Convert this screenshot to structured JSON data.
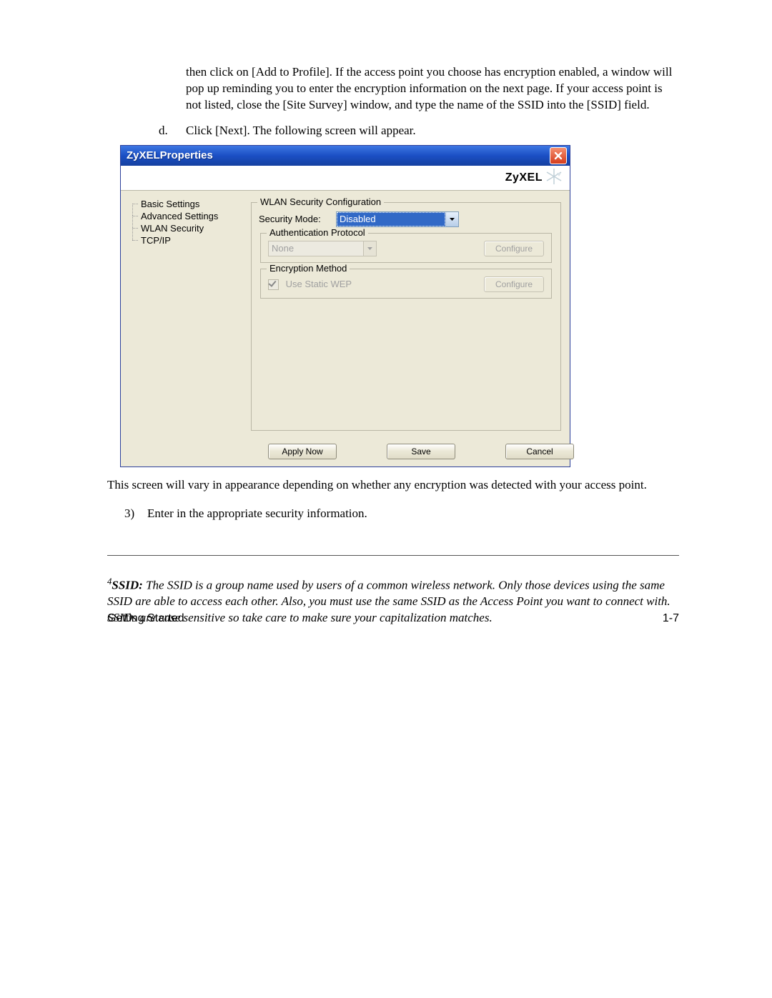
{
  "doc": {
    "para1": "then click on [Add to Profile].  If the access point you choose has encryption enabled, a window will pop up reminding you to enter the encryption information on the next page.  If your access point is not listed, close the [Site Survey] window, and type the name of the SSID into the [SSID] field.",
    "step_d_marker": "d.",
    "step_d_text": "Click [Next].  The following screen will appear.",
    "after_dialog": "This screen will vary in appearance depending on whether any encryption was detected with your access point.",
    "step_3_marker": "3)",
    "step_3_text": "Enter in the appropriate security information.",
    "footnote_sup": "4",
    "footnote_label": "SSID:",
    "footnote_text": " The SSID is a group name used by users of a common wireless network. Only those devices using the same SSID are able to access each other. Also, you must use the same SSID as the Access Point you want to connect with.  SSIDs are case sensitive so take care to make sure your capitalization matches.",
    "footer_left": "Getting Started",
    "footer_right": "1-7"
  },
  "dialog": {
    "title": "ZyXELProperties",
    "brand": "ZyXEL",
    "tree": {
      "basic": "Basic Settings",
      "advanced": "Advanced Settings",
      "wlan": "WLAN Security",
      "tcpip": "TCP/IP"
    },
    "group_outer": "WLAN Security Configuration",
    "security_mode_label": "Security Mode:",
    "security_mode_value": "Disabled",
    "group_auth": "Authentication Protocol",
    "auth_value": "None",
    "configure1": "Configure",
    "group_enc": "Encryption Method",
    "use_static_wep": "Use Static WEP",
    "configure2": "Configure",
    "apply": "Apply Now",
    "save": "Save",
    "cancel": "Cancel"
  }
}
